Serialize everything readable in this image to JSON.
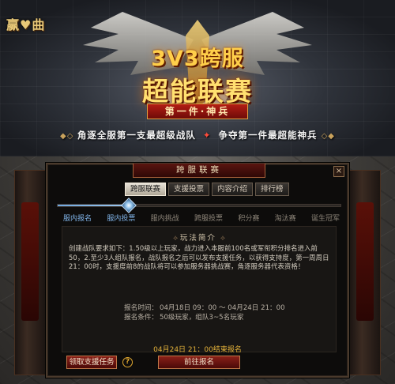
{
  "banner": {
    "logo": "赢♥曲",
    "title_line1": "3V3跨服",
    "title_line2": "超能联赛",
    "ribbon": "第一件·神兵",
    "tagline_left": "角逐全服第一支最超级战队",
    "tagline_right": "争夺第一件最超能神兵",
    "tagline_separator": "✦"
  },
  "panel": {
    "title": "跨服联赛",
    "close_label": "×",
    "tabs": [
      {
        "label": "跨服联赛",
        "active": true
      },
      {
        "label": "支援投票",
        "active": false
      },
      {
        "label": "内容介绍",
        "active": false
      },
      {
        "label": "排行榜",
        "active": false
      }
    ],
    "progress": 0.25,
    "stages": [
      {
        "label": "服内报名",
        "done": true
      },
      {
        "label": "服内投票",
        "done": true
      },
      {
        "label": "服内挑战",
        "done": false
      },
      {
        "label": "跨服投票",
        "done": false
      },
      {
        "label": "积分赛",
        "done": false
      },
      {
        "label": "淘汰赛",
        "done": false
      },
      {
        "label": "诞生冠军",
        "done": false
      }
    ],
    "rules_title": "玩法简介",
    "rules_text": "创建战队要求如下：1.50级以上玩家，战力进入本服前100名或军衔积分排名进入前50，2.至少3人组队报名，战队报名之后可以发布支援任务，以获得支持度，第一周周日21：00时，支援度前8的战队将可以参加服务器挑战赛，角逐服务器代表资格！",
    "info": {
      "time_label": "报名时间：",
      "time_value": "04月18日 09：00 ～ 04月24日 21：00",
      "cond_label": "报名条件：",
      "cond_value": "50级玩家，组队3~5名玩家"
    },
    "deadline": "04月24日 21：00结束报名",
    "support_button": "领取支援任务",
    "help_label": "?",
    "register_button": "前往报名"
  },
  "colors": {
    "accent_blue": "#7fb2e6",
    "gold": "#e4b23a",
    "button_red": "#8a2018"
  }
}
